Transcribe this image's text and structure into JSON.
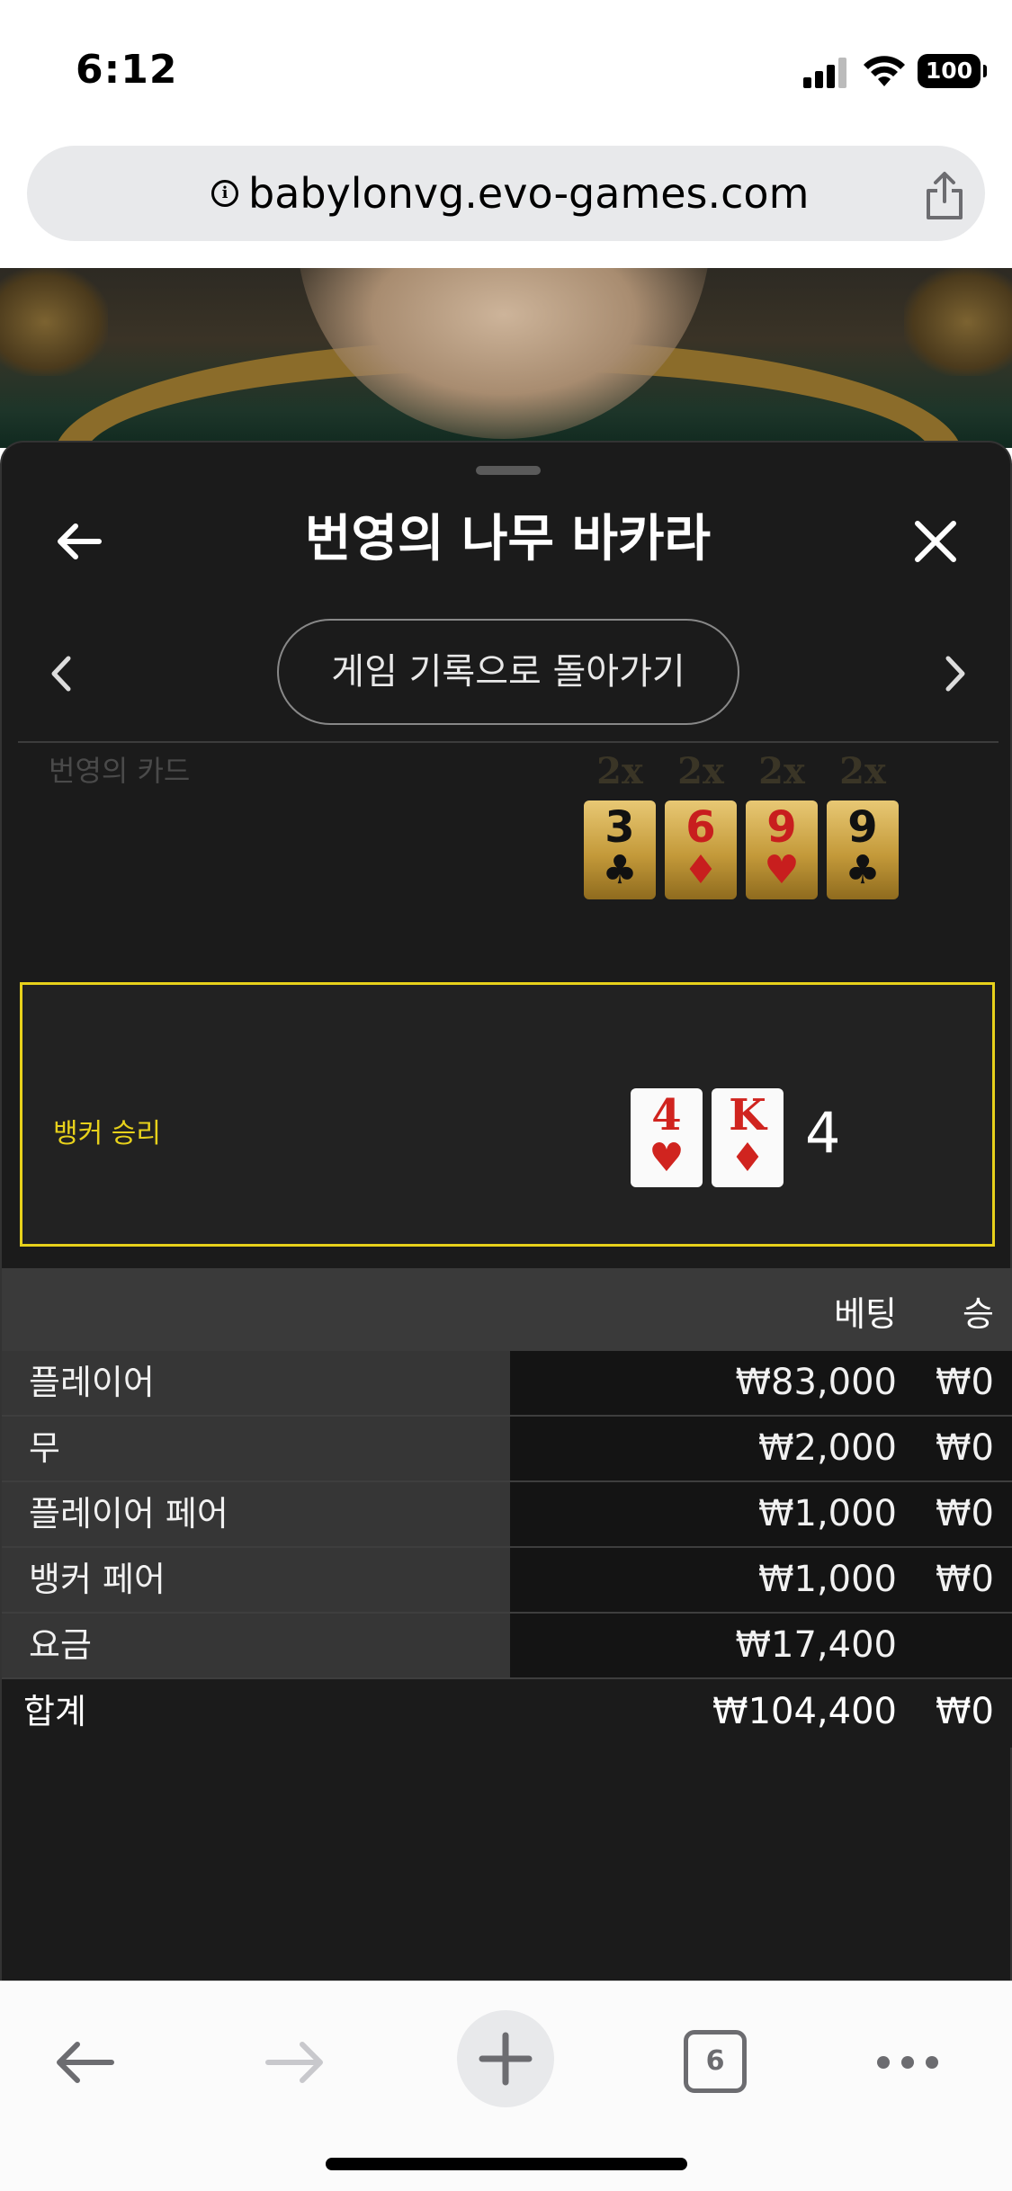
{
  "status_bar": {
    "time": "6:12",
    "battery": "100"
  },
  "browser": {
    "url": "babylonvg.evo-games.com",
    "tab_count": "6"
  },
  "sheet": {
    "title": "번영의 나무 바카라",
    "history_button": "게임 기록으로 돌아가기",
    "lucky_cards_label": "번영의 카드",
    "lucky_cards": [
      {
        "multiplier": "2x",
        "rank": "3",
        "suit": "♣",
        "color": "black"
      },
      {
        "multiplier": "2x",
        "rank": "6",
        "suit": "♦",
        "color": "red"
      },
      {
        "multiplier": "2x",
        "rank": "9",
        "suit": "♥",
        "color": "red"
      },
      {
        "multiplier": "2x",
        "rank": "9",
        "suit": "♣",
        "color": "black"
      }
    ],
    "result": {
      "label": "뱅커 승리",
      "score": "4",
      "cards": [
        {
          "rank": "4",
          "suit": "♥"
        },
        {
          "rank": "K",
          "suit": "♦"
        }
      ]
    },
    "bet_table": {
      "headers": {
        "bet": "베팅",
        "win": "승"
      },
      "rows": [
        {
          "name": "플레이어",
          "bet": "₩83,000",
          "win": "₩0"
        },
        {
          "name": "무",
          "bet": "₩2,000",
          "win": "₩0"
        },
        {
          "name": "플레이어 페어",
          "bet": "₩1,000",
          "win": "₩0"
        },
        {
          "name": "뱅커 페어",
          "bet": "₩1,000",
          "win": "₩0"
        },
        {
          "name": "요금",
          "bet": "₩17,400",
          "win": ""
        }
      ],
      "total": {
        "name": "합계",
        "bet": "₩104,400",
        "win": "₩0"
      }
    }
  },
  "colors": {
    "sheet_bg": "#1b1b1b",
    "highlight_yellow": "#e7d11b",
    "card_red": "#d0241f",
    "gold_card": "#c49a3a"
  }
}
